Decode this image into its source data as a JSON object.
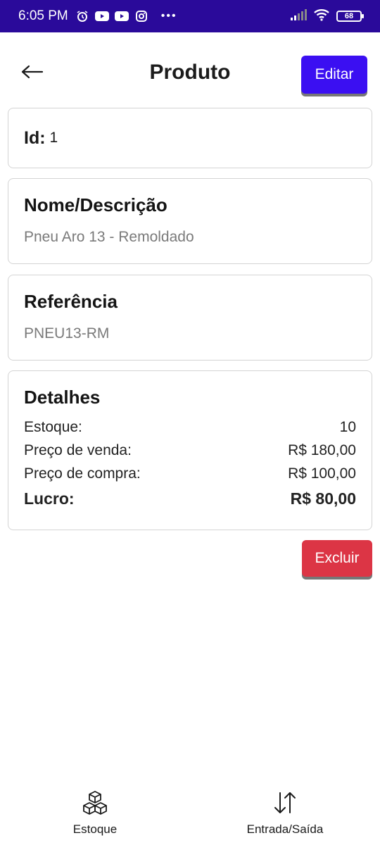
{
  "status_bar": {
    "time": "6:05 PM",
    "battery": "68",
    "icons": [
      "alarm-icon",
      "youtube-icon",
      "youtube-icon",
      "instagram-icon",
      "more-dots-icon",
      "signal-icon",
      "wifi-icon",
      "battery-icon"
    ]
  },
  "header": {
    "title": "Produto",
    "edit_label": "Editar"
  },
  "product": {
    "id_label": "Id:",
    "id_value": "1",
    "name_heading": "Nome/Descrição",
    "name_value": "Pneu Aro 13 - Remoldado",
    "ref_heading": "Referência",
    "ref_value": "PNEU13-RM"
  },
  "details": {
    "heading": "Detalhes",
    "rows": [
      {
        "label": "Estoque:",
        "value": "10"
      },
      {
        "label": "Preço de venda:",
        "value": "R$ 180,00"
      },
      {
        "label": "Preço de compra:",
        "value": "R$ 100,00"
      },
      {
        "label": "Lucro:",
        "value": "R$ 80,00"
      }
    ]
  },
  "actions": {
    "delete_label": "Excluir"
  },
  "bottom_nav": {
    "items": [
      {
        "label": "Estoque",
        "icon": "cubes-icon"
      },
      {
        "label": "Entrada/Saída",
        "icon": "arrows-up-down-icon"
      }
    ]
  },
  "colors": {
    "status_bar": "#2a0a9a",
    "primary": "#3b0ff2",
    "danger": "#dc3545"
  }
}
